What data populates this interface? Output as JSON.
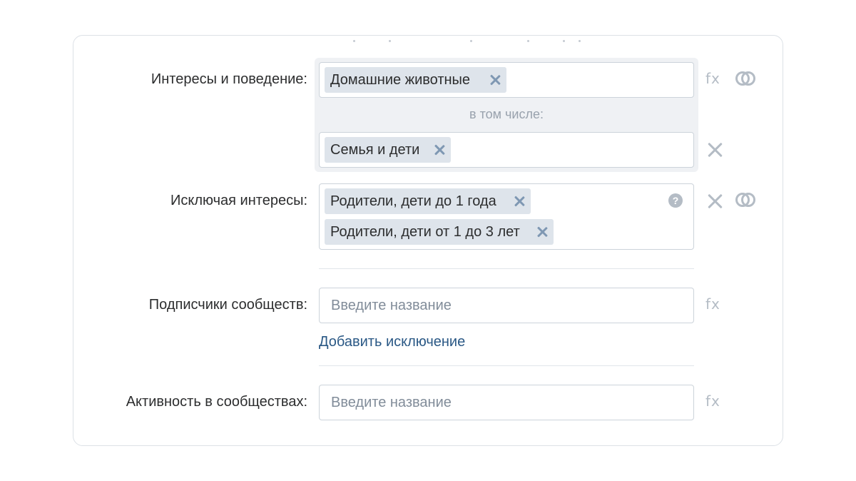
{
  "interests": {
    "label": "Интересы и поведение:",
    "tags": [
      {
        "text": "Домашние животные"
      }
    ],
    "including_label": "в том числе:",
    "included_tags": [
      {
        "text": "Семья и дети"
      }
    ],
    "formula_icon": "fx"
  },
  "excluding": {
    "label": "Исключая интересы:",
    "tags": [
      {
        "text": "Родители, дети до 1 года"
      },
      {
        "text": "Родители, дети от 1 до 3 лет"
      }
    ],
    "help_icon": "?"
  },
  "subscribers": {
    "label": "Подписчики сообществ:",
    "placeholder": "Введите название",
    "formula_icon": "fx",
    "add_exclusion": "Добавить исключение"
  },
  "activity": {
    "label": "Активность в сообществах:",
    "placeholder": "Введите название",
    "formula_icon": "fx"
  },
  "colors": {
    "tag_bg": "#dee4eb",
    "group_bg": "#eff1f4",
    "link": "#2a5885",
    "icon": "#b4bcc5"
  }
}
